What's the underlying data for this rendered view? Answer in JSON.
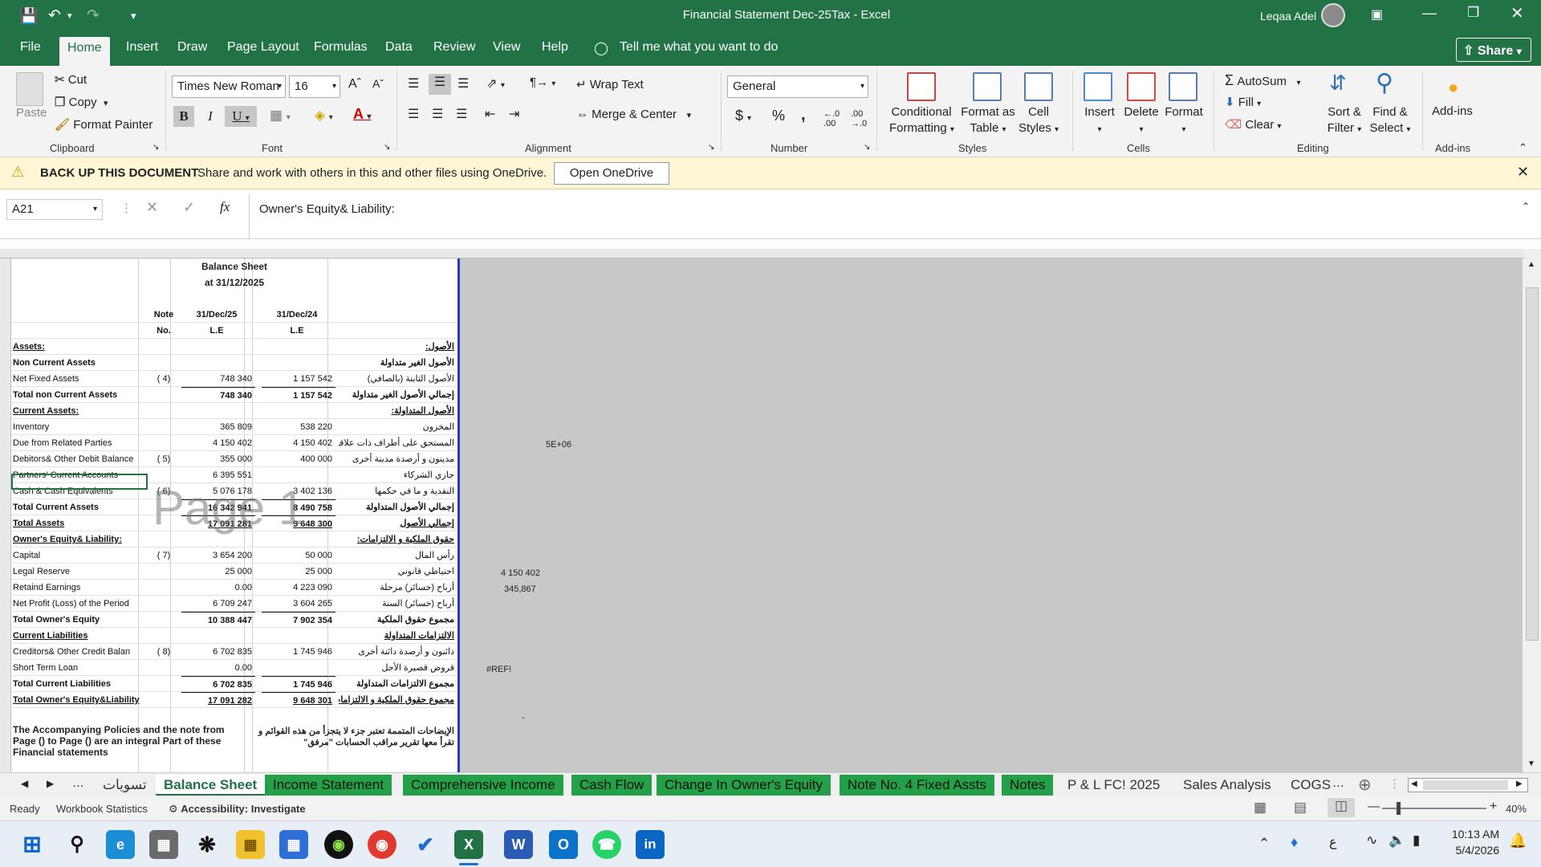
{
  "title_bar": {
    "title": "Financial Statement  Dec-25Tax  -  Excel",
    "user": "Leqaa Adel"
  },
  "tabs": [
    "File",
    "Home",
    "Insert",
    "Draw",
    "Page Layout",
    "Formulas",
    "Data",
    "Review",
    "View",
    "Help"
  ],
  "tell_me": "Tell me what you want to do",
  "share": "Share",
  "clipboard": {
    "paste": "Paste",
    "cut": "Cut",
    "copy": "Copy",
    "format_painter": "Format Painter",
    "label": "Clipboard"
  },
  "font": {
    "family": "Times New Roman",
    "size": "16",
    "label": "Font",
    "bold": "B",
    "italic": "I",
    "underline": "U"
  },
  "alignment": {
    "wrap": "Wrap Text",
    "merge": "Merge & Center",
    "label": "Alignment"
  },
  "number": {
    "format": "General",
    "currency": "$",
    "percent": "%",
    "comma": ",",
    "label": "Number"
  },
  "styles": {
    "conditional": [
      "Conditional",
      "Formatting"
    ],
    "table": [
      "Format as",
      "Table"
    ],
    "cell": [
      "Cell",
      "Styles"
    ],
    "label": "Styles"
  },
  "cells": {
    "insert": "Insert",
    "delete": "Delete",
    "format": "Format",
    "label": "Cells"
  },
  "editing": {
    "autosum": "AutoSum",
    "fill": "Fill",
    "clear": "Clear",
    "sort": [
      "Sort &",
      "Filter"
    ],
    "find": [
      "Find &",
      "Select"
    ],
    "label": "Editing"
  },
  "addins": {
    "addins": "Add-ins",
    "label": "Add-ins"
  },
  "message_bar": {
    "title": "BACK UP THIS DOCUMENT",
    "text": "Share and work with others in this and other files using OneDrive.",
    "button": "Open OneDrive"
  },
  "formula_bar": {
    "name_box": "A21",
    "fx": "fx",
    "content": "Owner's Equity& Liability:"
  },
  "sheet": {
    "title": "Balance Sheet",
    "date": "at 31/12/2025",
    "note_hdr": [
      "Note",
      "No."
    ],
    "col_d_hdr": [
      "31/Dec/25",
      "L.E"
    ],
    "col_f_hdr": [
      "31/Dec/24",
      "L.E"
    ],
    "watermark": "Page 1",
    "rows": [
      {
        "l": "Assets:",
        "n": "",
        "d": "",
        "f": "",
        "a": "الأصول:",
        "s": "bu"
      },
      {
        "l": "Non Current Assets",
        "n": "",
        "d": "",
        "f": "",
        "a": "الأصول الغير متداولة",
        "s": "b"
      },
      {
        "l": "Net Fixed Assets",
        "n": "( 4)",
        "d": "748 340",
        "f": "1 157 542",
        "a": "الأصول الثابتة (بالصافي)",
        "s": ""
      },
      {
        "l": "Total non Current Assets",
        "n": "",
        "d": "748 340",
        "f": "1 157 542",
        "a": "إجمالي الأصول الغير متداولة",
        "s": "bt"
      },
      {
        "l": "Current Assets:",
        "n": "",
        "d": "",
        "f": "",
        "a": "الأصول المتداولة:",
        "s": "bu"
      },
      {
        "l": "Inventory",
        "n": "",
        "d": "365 809",
        "f": "538 220",
        "a": "المخزون",
        "s": ""
      },
      {
        "l": "Due from Related Parties",
        "n": "",
        "d": "4 150 402",
        "f": "4 150 402",
        "a": "المستحق على أطراف ذات علاقة",
        "s": ""
      },
      {
        "l": "Debitors& Other Debit Balance",
        "n": "( 5)",
        "d": "355 000",
        "f": "400 000",
        "a": "مدينون و أرصدة مدينة أخرى",
        "s": ""
      },
      {
        "l": "Partners' Current Accounts",
        "n": "",
        "d": "6 395 551",
        "f": "",
        "a": "جاري الشركاء",
        "s": ""
      },
      {
        "l": "Cash & Cash Equivalents",
        "n": "( 6)",
        "d": "5 076 178",
        "f": "3 402 136",
        "a": "النقدية و ما في حكمها",
        "s": ""
      },
      {
        "l": "Total Current Assets",
        "n": "",
        "d": "16 342 941",
        "f": "8 490 758",
        "a": "إجمالي الأصول المتداولة",
        "s": "bt"
      },
      {
        "l": "Total Assets",
        "n": "",
        "d": "17 091 281",
        "f": "9 648 300",
        "a": "إجمالي الأصول",
        "s": "btu"
      },
      {
        "l": "Owner's Equity& Liability:",
        "n": "",
        "d": "",
        "f": "",
        "a": "حقوق الملكية و الالتزامات:",
        "s": "bu"
      },
      {
        "l": "Capital",
        "n": "( 7)",
        "d": "3 654 200",
        "f": "50 000",
        "a": "رأس المال",
        "s": ""
      },
      {
        "l": "Legal Reserve",
        "n": "",
        "d": "25 000",
        "f": "25 000",
        "a": "احتياطي قانوني",
        "s": ""
      },
      {
        "l": "Retaind Earnings",
        "n": "",
        "d": "0.00",
        "f": "4 223 090",
        "a": "أرباح (خسائر) مرحلة",
        "s": ""
      },
      {
        "l": "Net Profit (Loss) of the Period",
        "n": "",
        "d": "6 709 247",
        "f": "3 604 265",
        "a": "أرباح (خسائر) السنة",
        "s": ""
      },
      {
        "l": "Total Owner's Equity",
        "n": "",
        "d": "10 388 447",
        "f": "7 902 354",
        "a": "مجموع حقوق الملكية",
        "s": "bt"
      },
      {
        "l": "Current Liabilities",
        "n": "",
        "d": "",
        "f": "",
        "a": "الالتزامات المتداولة",
        "s": "bu"
      },
      {
        "l": "Creditors& Other Credit Balan",
        "n": "( 8)",
        "d": "6 702 835",
        "f": "1 745 946",
        "a": "دائنون و أرصدة دائنة أخرى",
        "s": ""
      },
      {
        "l": "Short Term Loan",
        "n": "",
        "d": "0.00",
        "f": "",
        "a": "قروض قصيرة الأجل",
        "s": ""
      },
      {
        "l": "Total Current Liabilities",
        "n": "",
        "d": "6 702 835",
        "f": "1 745 946",
        "a": "مجموع الالتزامات المتداولة",
        "s": "bt"
      },
      {
        "l": "Total Owner's Equity&Liability",
        "n": "",
        "d": "17 091 282",
        "f": "9 648 301",
        "a": "مجموع حقوق الملكية و الالتزامات",
        "s": "btu"
      }
    ],
    "footer_en": "The Accompanying Policies and the note from Page () to Page () are an integral Part of these Financial statements",
    "footer_ar": "الإيضاحات المتممة تعتبر جزء لا يتجزأ من هذه القوائم و تقرأ معها     تقرير مراقب الحسابات \"مرفق\"",
    "side_values": [
      "5E+06",
      "4 150 402",
      "345,867",
      "#REF!",
      "-"
    ]
  },
  "sheet_tabs": [
    "تسويات",
    "Balance Sheet",
    "Income Statement",
    "Comprehensive Income",
    "Cash Flow",
    "Change In Owner's Equity",
    "Note No. 4 Fixed Assts",
    "Notes",
    "P & L FC! 2025",
    "Sales Analysis",
    "COGS"
  ],
  "status": {
    "ready": "Ready",
    "workbook": "Workbook Statistics",
    "accessibility": "Accessibility: Investigate",
    "zoom": "40%"
  },
  "taskbar": {
    "time": "10:13 AM",
    "date": "5/4/2026",
    "lang": "ع"
  }
}
